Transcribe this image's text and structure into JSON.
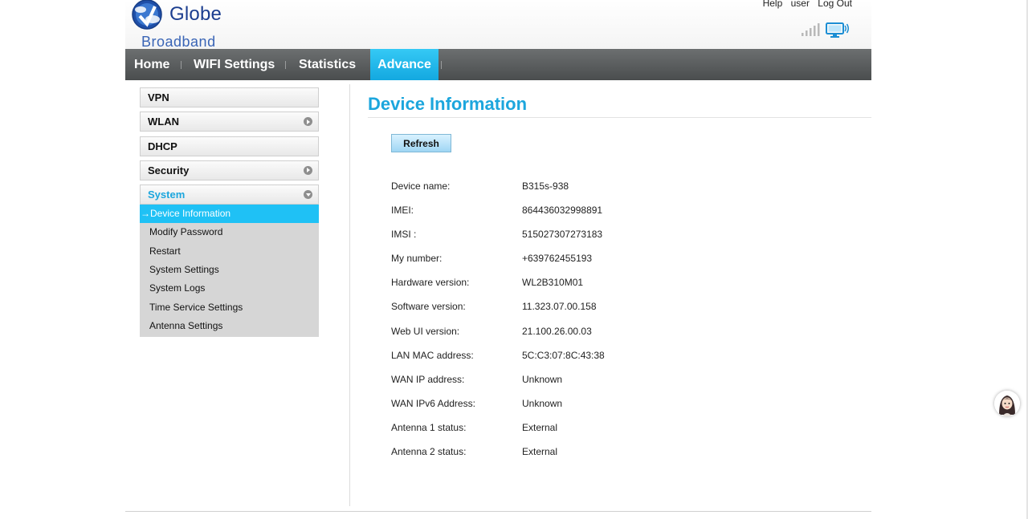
{
  "header": {
    "brand": "Globe",
    "brand_sub": "Broadband",
    "links": {
      "help": "Help",
      "user": "user",
      "logout": "Log Out"
    }
  },
  "nav": {
    "items": [
      {
        "label": "Home"
      },
      {
        "label": "WIFI Settings"
      },
      {
        "label": "Statistics"
      },
      {
        "label": "Advance",
        "active": true
      }
    ]
  },
  "sidebar": {
    "sections": [
      {
        "label": "VPN"
      },
      {
        "label": "WLAN"
      },
      {
        "label": "DHCP"
      },
      {
        "label": "Security"
      },
      {
        "label": "System",
        "open": true
      }
    ],
    "system_items": [
      {
        "label": "Device Information",
        "active": true
      },
      {
        "label": "Modify Password"
      },
      {
        "label": "Restart"
      },
      {
        "label": "System Settings"
      },
      {
        "label": "System Logs"
      },
      {
        "label": "Time Service Settings"
      },
      {
        "label": "Antenna Settings"
      }
    ]
  },
  "main": {
    "title": "Device Information",
    "refresh_label": "Refresh",
    "info": [
      {
        "label": "Device name:",
        "value": "B315s-938"
      },
      {
        "label": "IMEI:",
        "value": "864436032998891"
      },
      {
        "label": "IMSI :",
        "value": "515027307273183"
      },
      {
        "label": "My number:",
        "value": "+639762455193"
      },
      {
        "label": "Hardware version:",
        "value": "WL2B310M01"
      },
      {
        "label": "Software version:",
        "value": "11.323.07.00.158"
      },
      {
        "label": "Web UI version:",
        "value": "21.100.26.00.03"
      },
      {
        "label": "LAN MAC address:",
        "value": "5C:C3:07:8C:43:38"
      },
      {
        "label": "WAN IP address:",
        "value": "Unknown"
      },
      {
        "label": "WAN IPv6 Address:",
        "value": "Unknown"
      },
      {
        "label": "Antenna 1 status:",
        "value": "External"
      },
      {
        "label": "Antenna 2 status:",
        "value": "External"
      }
    ]
  },
  "icons": {
    "logo": "globe-logo-icon",
    "signal": "signal-strength-icon",
    "connection": "monitor-connection-icon",
    "arrow": "arrow-right-icon",
    "chevron": "chevron-circle-icon",
    "avatar": "chat-avatar-icon"
  },
  "colors": {
    "accent": "#1ca6dd",
    "nav_bg": "#55595a",
    "active_tab": "#13a8e0",
    "brand": "#1b3d8f"
  }
}
